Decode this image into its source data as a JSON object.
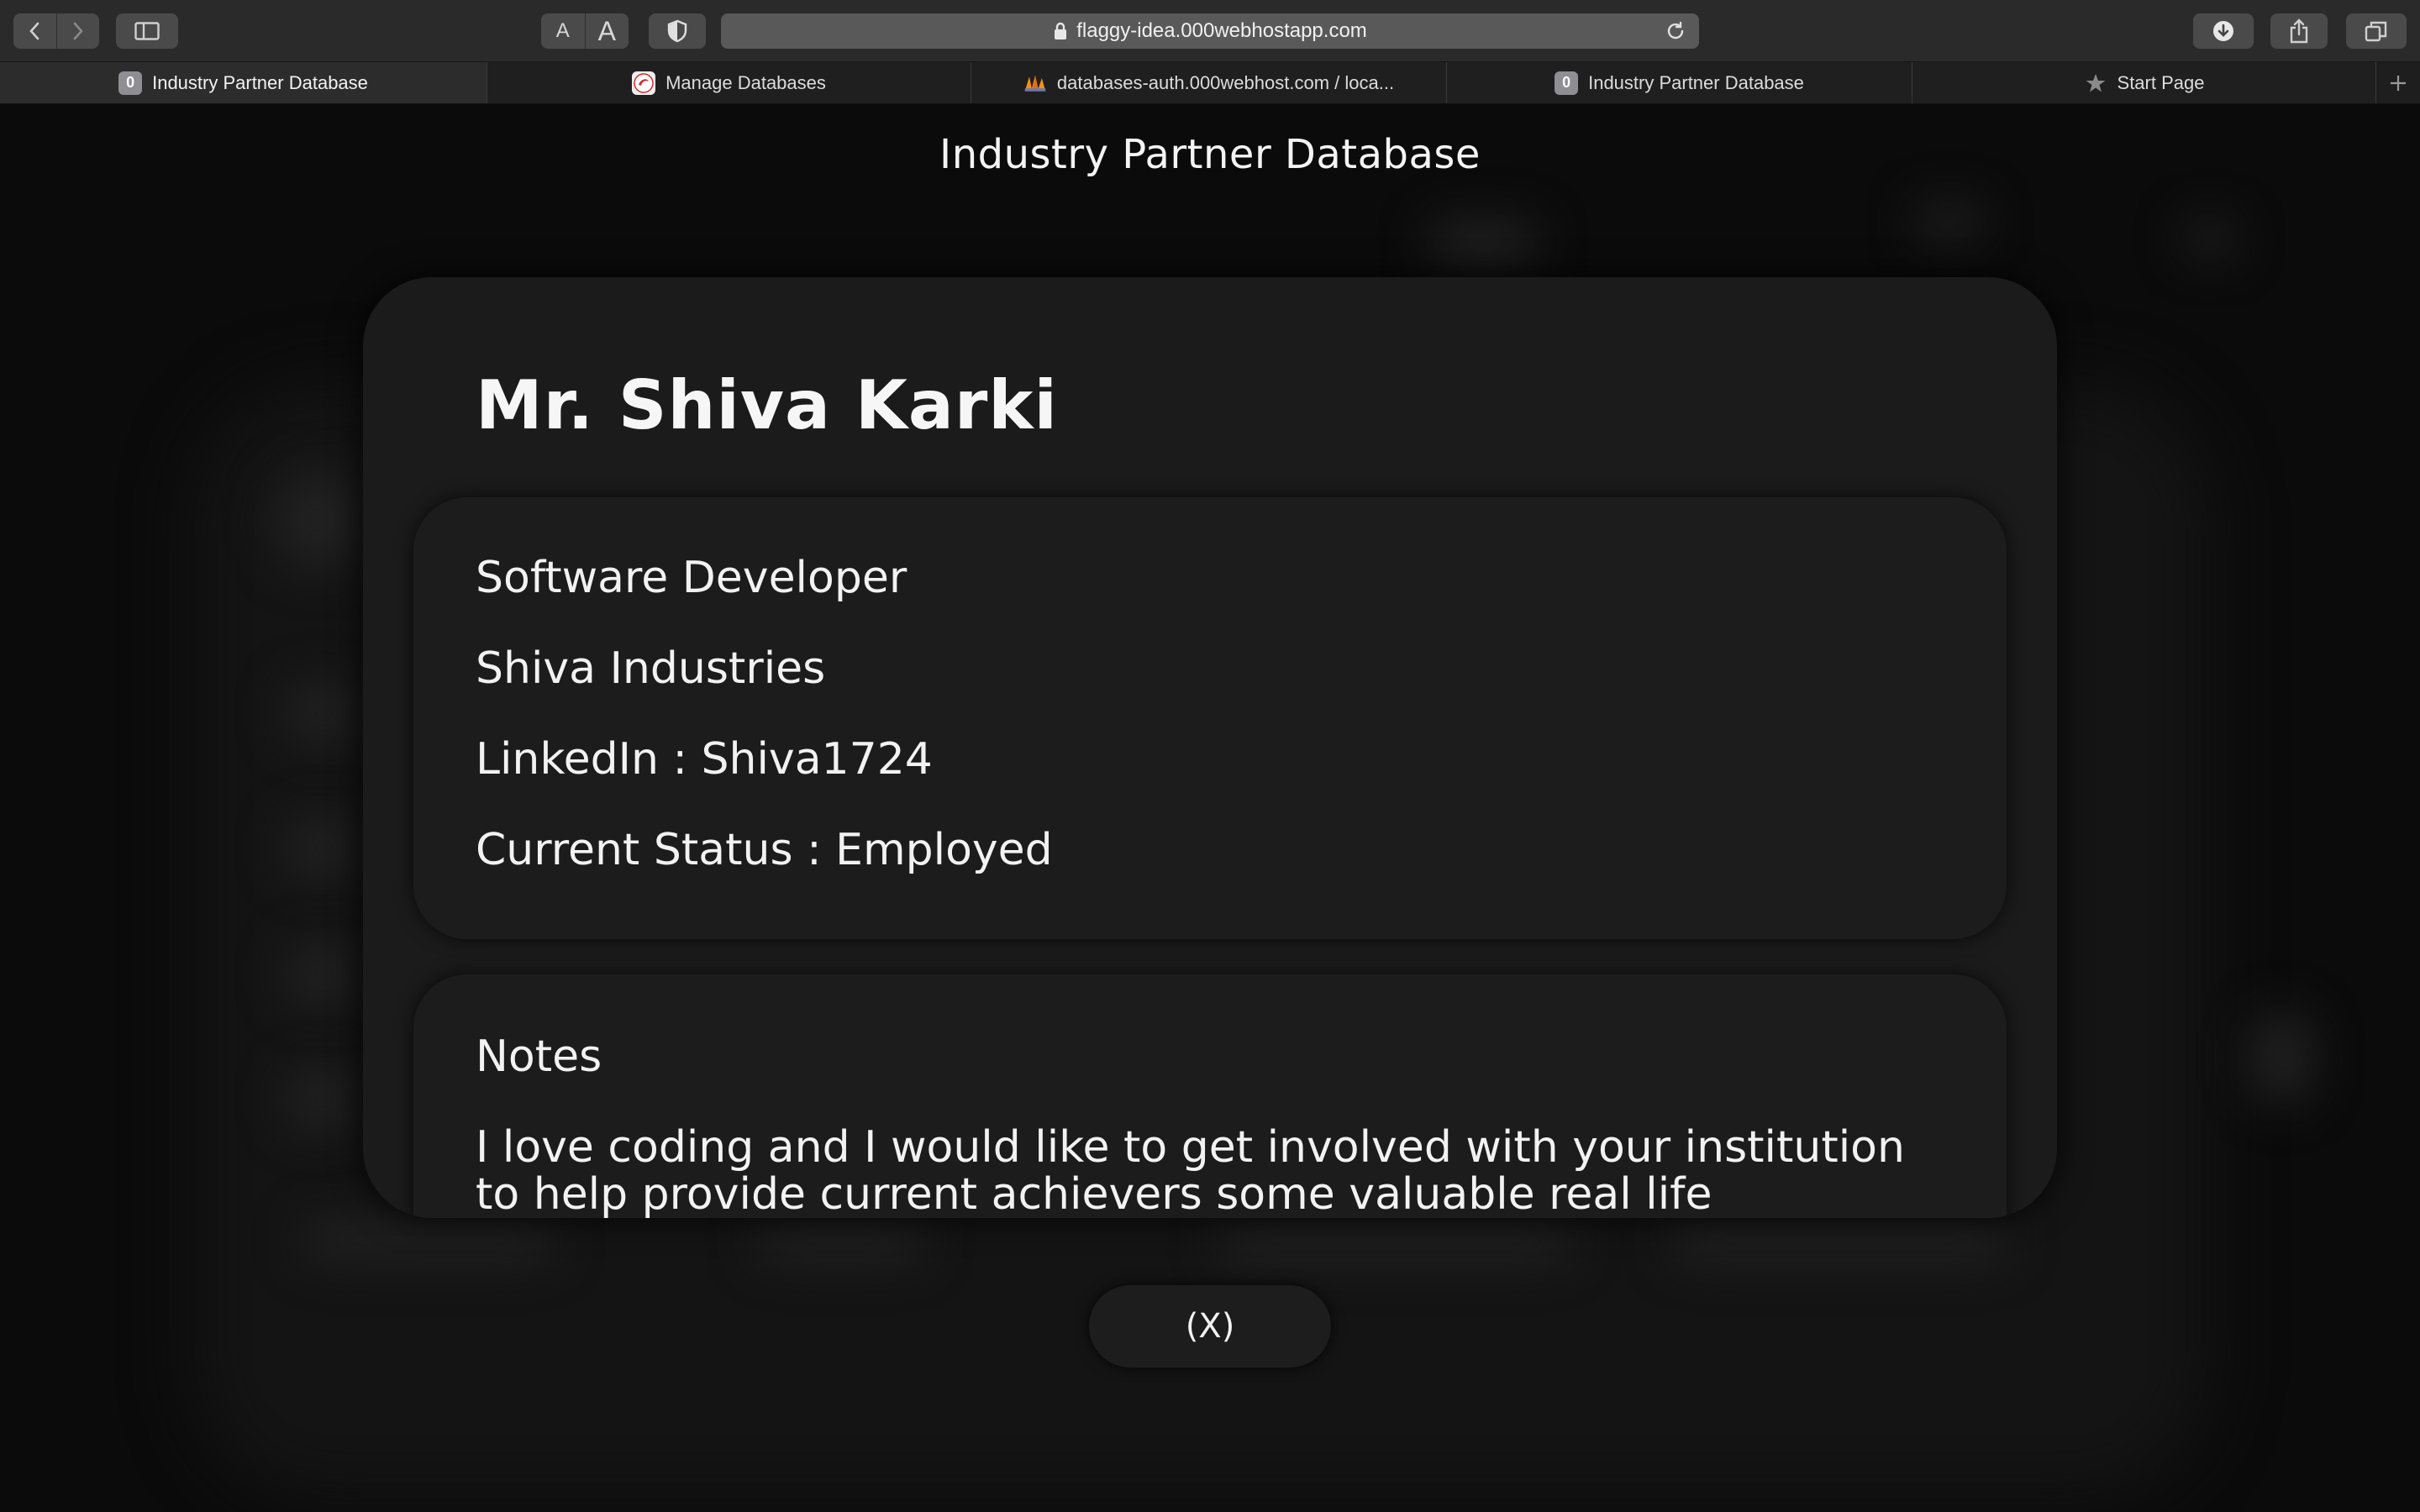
{
  "browser": {
    "url": "flaggy-idea.000webhostapp.com",
    "text_size_small": "A",
    "text_size_large": "A",
    "tabs": [
      {
        "label": "Industry Partner Database",
        "favicon": "0",
        "active": true
      },
      {
        "label": "Manage Databases",
        "favicon": "database-logo-icon",
        "active": false
      },
      {
        "label": "databases-auth.000webhost.com / loca...",
        "favicon": "phpmyadmin-icon",
        "active": false
      },
      {
        "label": "Industry Partner Database",
        "favicon": "0",
        "active": false
      },
      {
        "label": "Start Page",
        "favicon": "star-icon",
        "active": false
      }
    ]
  },
  "page": {
    "title": "Industry Partner Database"
  },
  "profile": {
    "name": "Mr. Shiva Karki",
    "position": "Software Developer",
    "company": "Shiva Industries",
    "linkedin": "LinkedIn : Shiva1724",
    "status": "Current Status : Employed",
    "notes_heading": "Notes",
    "notes_text": "I love coding and I would like to get involved with your institution to help provide current achievers some valuable real life experience in"
  },
  "close_label": "(X)"
}
